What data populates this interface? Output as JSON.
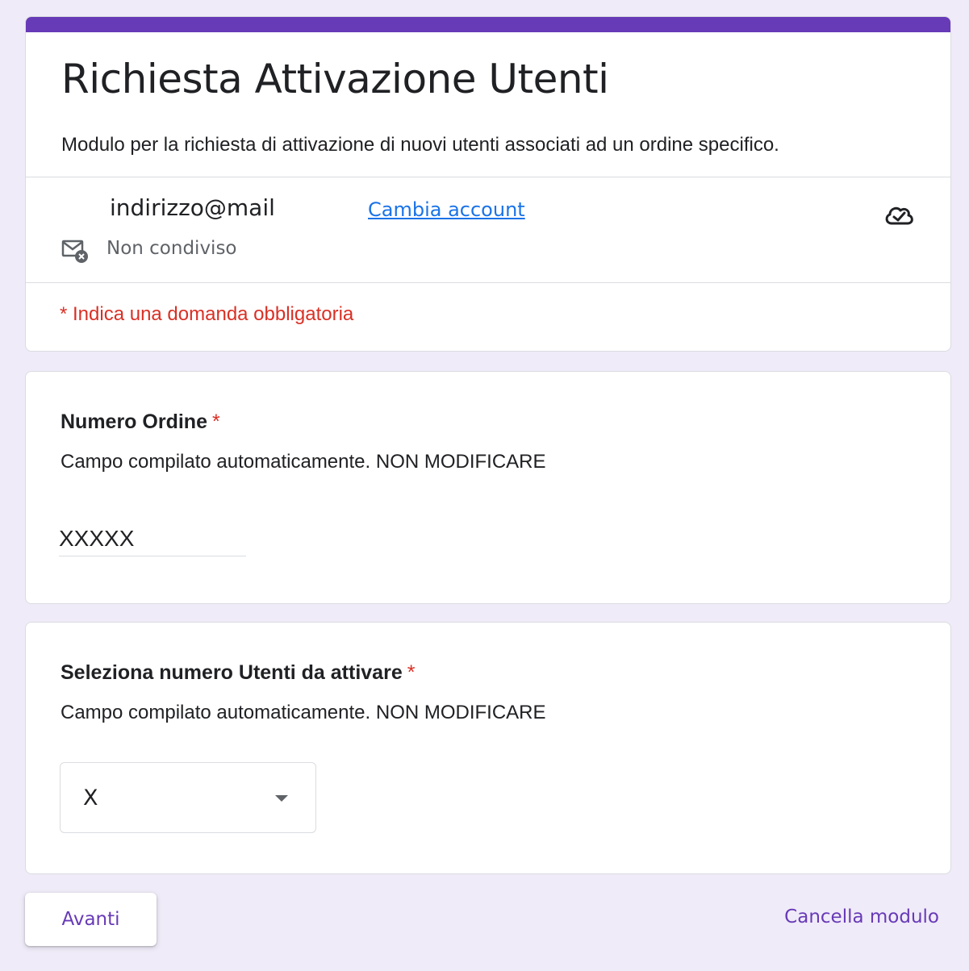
{
  "form": {
    "title": "Richiesta Attivazione Utenti",
    "description": "Modulo per la richiesta di attivazione di nuovi utenti associati ad un ordine specifico.",
    "accent_color": "#673ab7"
  },
  "account": {
    "email": "indirizzo@mail",
    "switch_label": "Cambia account",
    "shared_status": "Non condiviso",
    "cloud_icon": "cloud-check-icon",
    "mail_icon": "mail-not-shared-icon"
  },
  "required_note": "* Indica una domanda obbligatoria",
  "questions": [
    {
      "title": "Numero Ordine",
      "required_mark": "*",
      "description": "Campo compilato automaticamente. NON MODIFICARE",
      "value": "XXXXX"
    },
    {
      "title": "Seleziona numero Utenti da attivare",
      "required_mark": "*",
      "description": "Campo compilato automaticamente. NON MODIFICARE",
      "value": "X",
      "icon": "caret-down-icon"
    }
  ],
  "actions": {
    "next_label": "Avanti",
    "clear_label": "Cancella modulo"
  }
}
